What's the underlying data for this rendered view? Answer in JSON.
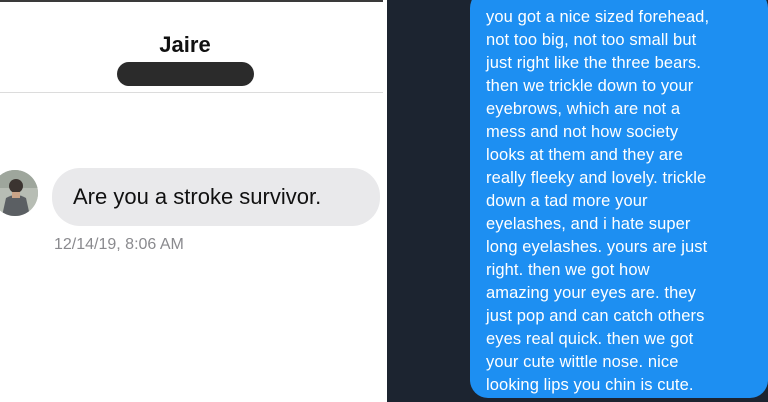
{
  "left_chat": {
    "contact_name": "Jaire",
    "incoming_message": "Are you a stroke survivor.",
    "timestamp": "12/14/19, 8:06 AM"
  },
  "right_chat": {
    "outgoing_message": "you got a nice sized forehead,\nnot too big, not too small but\njust right like the three bears.\nthen we trickle down to your\neyebrows, which are not a\nmess and not how society\nlooks at them and they are\nreally fleeky and lovely. trickle\ndown a tad more your\neyelashes, and i hate super\nlong eyelashes. yours are just\nright. then we got how\namazing your eyes are. they\njust pop and can catch others\neyes real quick. then we got\nyour cute wittle nose. nice\nlooking lips you chin is cute."
  },
  "colors": {
    "incoming_bubble": "#e9e9eb",
    "outgoing_bubble": "#1d8ff2",
    "right_background": "#1c2430",
    "redaction": "#2b2b2b"
  }
}
